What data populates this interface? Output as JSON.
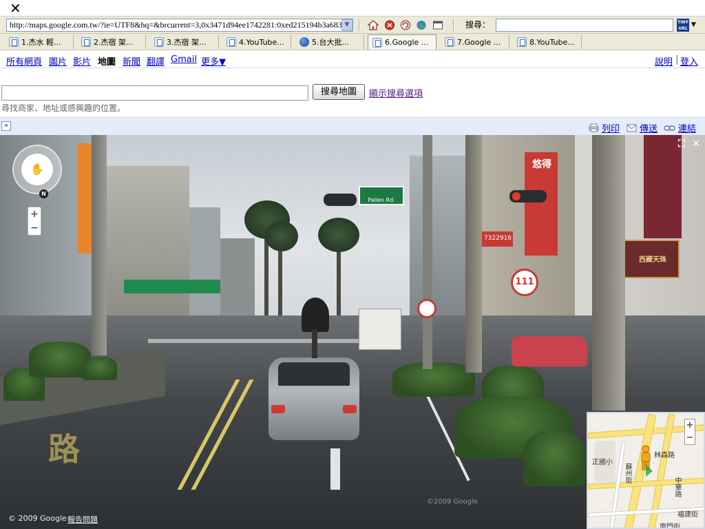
{
  "closebar": {
    "close_label": "✕"
  },
  "toolbar": {
    "address": "http://maps.google.com.tw/?ie=UTF8&hq=&brcurrent=3,0x3471d94ee1742281:0xed215194b3a68355",
    "search_label": "搜尋：",
    "search_value": "",
    "tinyurl_label": "TINY URL",
    "icons": [
      "home-icon",
      "stop-icon",
      "refresh-icon",
      "globe-icon",
      "window-icon"
    ]
  },
  "tabs": [
    {
      "label": "1.杰水 輕...",
      "icon": "page-icon",
      "active": false
    },
    {
      "label": "2.杰宿 架...",
      "icon": "page-icon",
      "active": false
    },
    {
      "label": "3.杰宿 架...",
      "icon": "page-icon",
      "active": false
    },
    {
      "label": "4.YouTube...",
      "icon": "page-icon",
      "active": false
    },
    {
      "label": "5.台大批...",
      "icon": "globe-icon",
      "active": false
    },
    {
      "label": "6.Google ...",
      "icon": "page-icon",
      "active": true
    },
    {
      "label": "7.Google ...",
      "icon": "page-icon",
      "active": false
    },
    {
      "label": "8.YouTube...",
      "icon": "page-icon",
      "active": false
    }
  ],
  "gnav": {
    "items": [
      "所有網頁",
      "圖片",
      "影片",
      "地圖",
      "新聞",
      "翻譯",
      "Gmail",
      "更多▼"
    ],
    "current": "地圖",
    "help": "說明",
    "signin": "登入",
    "separator": "|"
  },
  "search": {
    "input_value": "",
    "button_label": "搜尋地圖",
    "options_link": "顯示搜尋選項",
    "hint": "尋找商家、地址或感興趣的位置。"
  },
  "mapbar": {
    "collapse_label": "»",
    "print": "列印",
    "send": "傳送",
    "link": "連結"
  },
  "streetview": {
    "compass_label": "N",
    "zoom_in": "+",
    "zoom_out": "−",
    "expand_label": "⛶",
    "close_label": "✕",
    "copyright": "© 2009 Google",
    "report": "報告問題",
    "watermark": "©2009 Google",
    "signs": {
      "street": "Pallen Rd.",
      "shop1": "悠得",
      "shop2": "西藏天珠",
      "number": "111",
      "phone": "7322916"
    }
  },
  "minimap": {
    "zoom_in": "+",
    "zoom_out": "−",
    "labels": [
      "正國小",
      "蘇州街",
      "林森路",
      "中華路",
      "福建街",
      "廈門街"
    ]
  }
}
